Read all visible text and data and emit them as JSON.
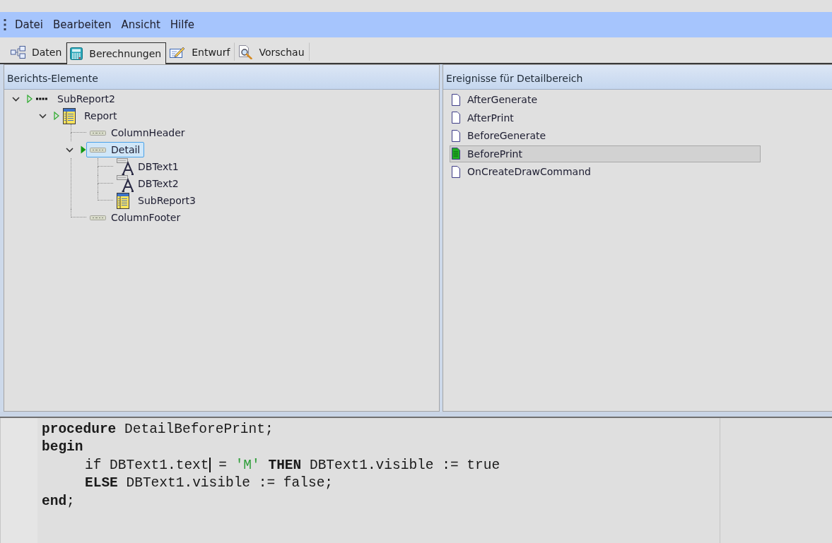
{
  "menu": [
    "Datei",
    "Bearbeiten",
    "Ansicht",
    "Hilfe"
  ],
  "tabs": [
    {
      "label": "Daten",
      "kind": "data",
      "selected": false
    },
    {
      "label": "Berechnungen",
      "kind": "calc",
      "selected": true
    },
    {
      "label": "Entwurf",
      "kind": "design",
      "selected": false
    },
    {
      "label": "Vorschau",
      "kind": "preview",
      "selected": false
    }
  ],
  "tree": {
    "title": "Berichts-Elemente",
    "items": [
      {
        "label": "SubReport2",
        "kind": "root",
        "handled": false,
        "expanded": true,
        "selected": false,
        "children": [
          {
            "label": "Report",
            "kind": "report",
            "handled": false,
            "expanded": true,
            "selected": false,
            "children": [
              {
                "label": "ColumnHeader",
                "kind": "band",
                "selected": false
              },
              {
                "label": "Detail",
                "kind": "band",
                "handled": true,
                "expanded": true,
                "selected": true,
                "children": [
                  {
                    "label": "DBText1",
                    "kind": "field",
                    "selected": false
                  },
                  {
                    "label": "DBText2",
                    "kind": "field",
                    "selected": false
                  },
                  {
                    "label": "SubReport3",
                    "kind": "subreport",
                    "selected": false
                  }
                ]
              },
              {
                "label": "ColumnFooter",
                "kind": "band",
                "selected": false
              }
            ]
          }
        ]
      }
    ]
  },
  "events": {
    "title": "Ereignisse für Detailbereich",
    "items": [
      {
        "label": "AfterGenerate",
        "selected": false,
        "handled": false
      },
      {
        "label": "AfterPrint",
        "selected": false,
        "handled": false
      },
      {
        "label": "BeforeGenerate",
        "selected": false,
        "handled": false
      },
      {
        "label": "BeforePrint",
        "selected": true,
        "handled": true
      },
      {
        "label": "OnCreateDrawCommand",
        "selected": false,
        "handled": false
      }
    ]
  },
  "editor": {
    "lines": [
      {
        "tokens": [
          {
            "kind": "keyword",
            "text": "procedure"
          },
          {
            "kind": "plain",
            "text": " DetailBeforePrint;"
          }
        ]
      },
      {
        "tokens": [
          {
            "kind": "keyword",
            "text": "begin"
          }
        ],
        "children": [
          {
            "tokens": [
              {
                "kind": "plain",
                "text": "if DBText1.text"
              },
              {
                "kind": "caret"
              },
              {
                "kind": "plain",
                "text": " = "
              },
              {
                "kind": "string",
                "text": "'M'"
              },
              {
                "kind": "keyword",
                "text": " THEN"
              },
              {
                "kind": "plain",
                "text": " DBText1.visible := true"
              }
            ]
          },
          {
            "tokens": [
              {
                "kind": "keyword",
                "text": "ELSE"
              },
              {
                "kind": "plain",
                "text": " DBText1.visible := false;"
              }
            ]
          }
        ]
      },
      {
        "tokens": [
          {
            "kind": "keyword",
            "text": "end"
          },
          {
            "kind": "plain",
            "text": ";"
          }
        ]
      }
    ]
  }
}
